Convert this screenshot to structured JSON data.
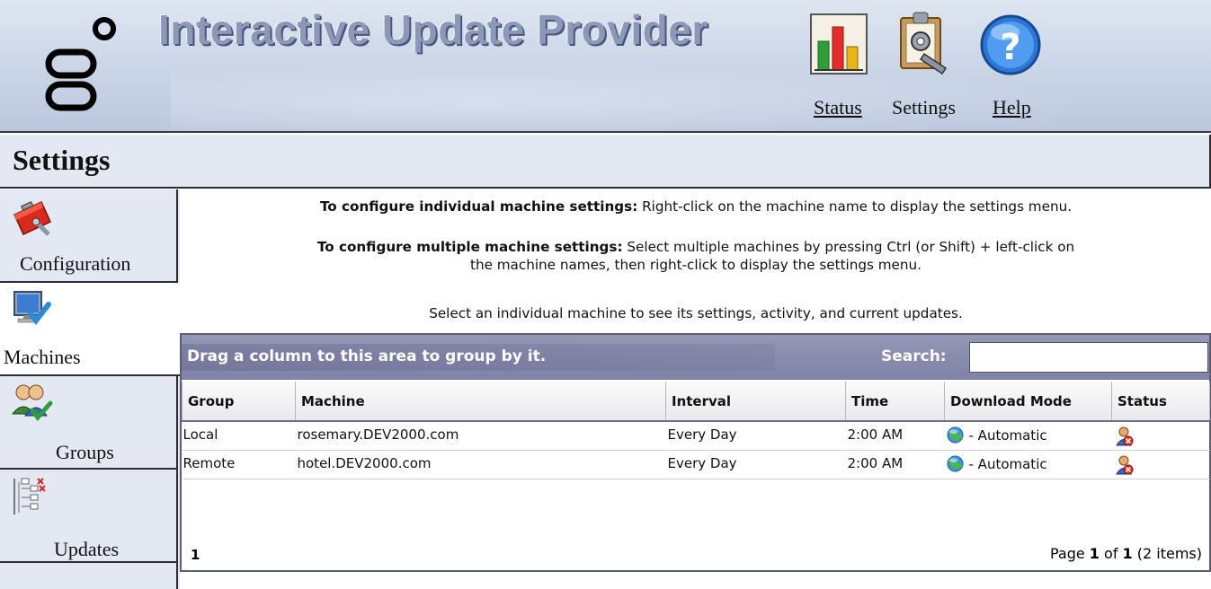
{
  "header": {
    "app_title": "Interactive Update Provider",
    "nav": [
      {
        "label": "Status",
        "icon": "bar-chart-icon"
      },
      {
        "label": "Settings",
        "icon": "clipboard-gear-icon"
      },
      {
        "label": "Help",
        "icon": "help-icon"
      }
    ]
  },
  "section": {
    "title": "Settings"
  },
  "sidebar": {
    "items": [
      {
        "label": "Configuration",
        "icon": "toolbox-icon"
      },
      {
        "label": "Machines",
        "icon": "monitor-check-icon",
        "active": true
      },
      {
        "label": "Groups",
        "icon": "users-check-icon"
      },
      {
        "label": "Updates",
        "icon": "tree-list-icon"
      }
    ]
  },
  "instructions": {
    "line1_bold": "To configure individual machine settings:",
    "line1_rest": " Right-click on the machine name to display the settings menu.",
    "line2_bold": "To configure multiple machine settings:",
    "line2_rest": " Select multiple machines by pressing Ctrl (or Shift) + left-click on",
    "line2_cont": "the machine names, then right-click to display the settings menu.",
    "line3": "Select an individual machine to see its settings, activity, and current updates."
  },
  "grid": {
    "group_hint": "Drag a column to this area to group by it.",
    "search_label": "Search:",
    "search_value": "",
    "columns": [
      "Group",
      "Machine",
      "Interval",
      "Time",
      "Download Mode",
      "Status"
    ],
    "rows": [
      {
        "group": "Local",
        "machine": "rosemary.DEV2000.com",
        "interval": "Every Day",
        "time": "2:00 AM",
        "mode": "- Automatic"
      },
      {
        "group": "Remote",
        "machine": "hotel.DEV2000.com",
        "interval": "Every Day",
        "time": "2:00 AM",
        "mode": "- Automatic"
      }
    ],
    "pager": {
      "current_page_link": "1",
      "page_prefix": "Page ",
      "page": "1",
      "of": " of ",
      "total_pages": "1",
      "items": " (2 items)"
    }
  }
}
